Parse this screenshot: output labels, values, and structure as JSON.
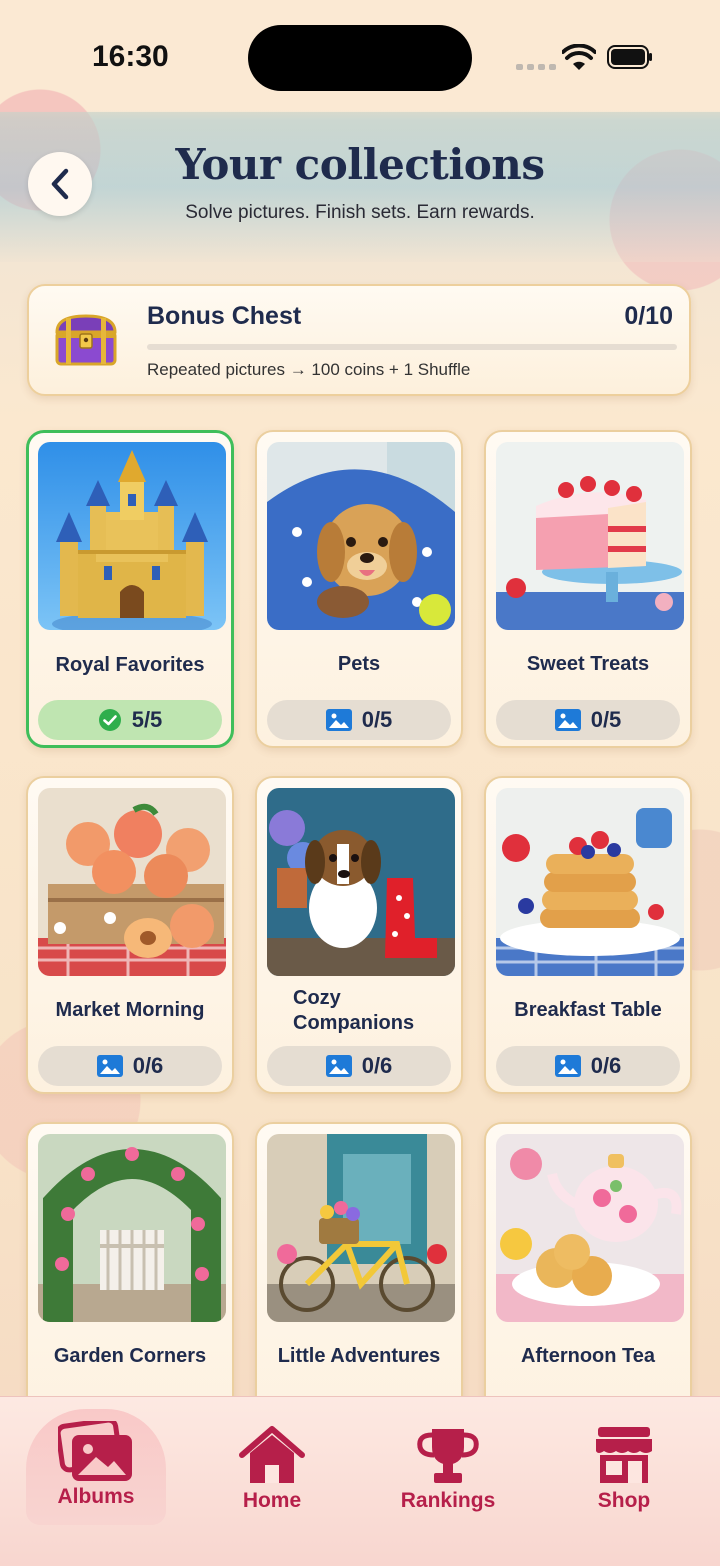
{
  "status_bar": {
    "time": "16:30"
  },
  "header": {
    "title": "Your collections",
    "subtitle": "Solve pictures. Finish sets. Earn rewards."
  },
  "bonus_chest": {
    "title": "Bonus Chest",
    "count": "0/10",
    "progress_fraction": 0,
    "description": "Repeated pictures → 100 coins + 1 Shuffle"
  },
  "albums": [
    {
      "name": "Royal Favorites",
      "progress": "5/5",
      "completed": true,
      "image": "castle"
    },
    {
      "name": "Pets",
      "progress": "0/5",
      "completed": false,
      "image": "puppy-blanket"
    },
    {
      "name": "Sweet Treats",
      "progress": "0/5",
      "completed": false,
      "image": "strawberry-cake"
    },
    {
      "name": "Market Morning",
      "progress": "0/6",
      "completed": false,
      "image": "peaches"
    },
    {
      "name": "Cozy Companions",
      "progress": "0/6",
      "completed": false,
      "image": "beagle-boots"
    },
    {
      "name": "Breakfast Table",
      "progress": "0/6",
      "completed": false,
      "image": "pancakes"
    },
    {
      "name": "Garden Corners",
      "progress": "",
      "completed": false,
      "image": "rose-arch-gate"
    },
    {
      "name": "Little Adventures",
      "progress": "",
      "completed": false,
      "image": "yellow-bicycle"
    },
    {
      "name": "Afternoon Tea",
      "progress": "",
      "completed": false,
      "image": "teapot-cookies"
    }
  ],
  "nav": [
    {
      "label": "Albums",
      "icon": "albums-icon",
      "active": true
    },
    {
      "label": "Home",
      "icon": "home-icon",
      "active": false
    },
    {
      "label": "Rankings",
      "icon": "trophy-icon",
      "active": false
    },
    {
      "label": "Shop",
      "icon": "shop-icon",
      "active": false
    }
  ],
  "colors": {
    "accent": "#b61f4a",
    "title": "#1f2b4d",
    "complete_border": "#3fbe5a",
    "complete_pill": "#bfe5b1",
    "pill": "#e5ddd2",
    "card_border": "#ebcf9f"
  }
}
